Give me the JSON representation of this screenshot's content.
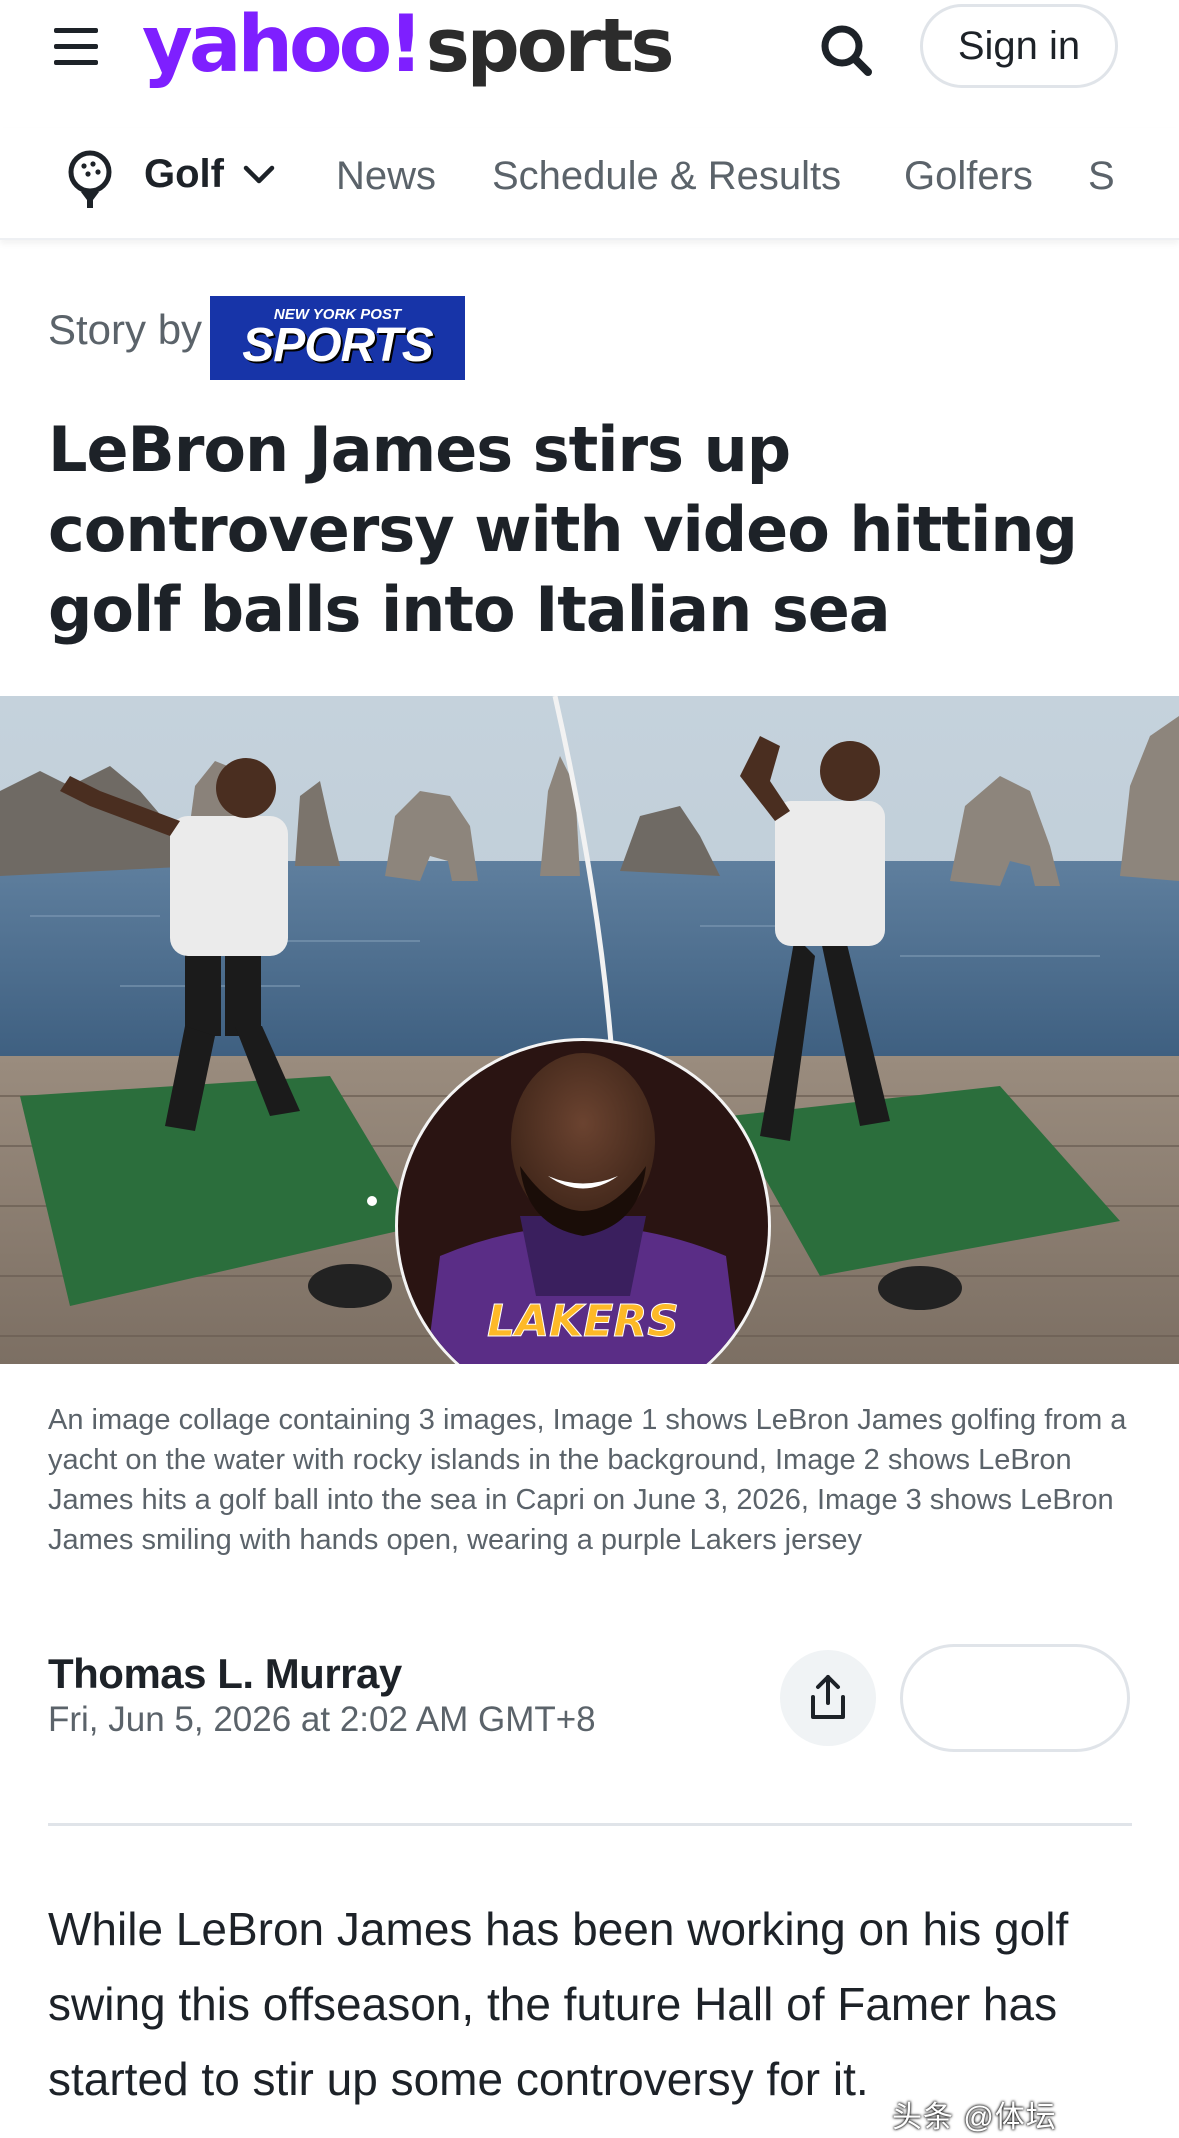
{
  "header": {
    "logo_main": "yahoo!",
    "logo_sub": "sports",
    "sign_in_label": "Sign in"
  },
  "subnav": {
    "sport_label": "Golf",
    "links": [
      "News",
      "Schedule & Results",
      "Golfers",
      "S"
    ]
  },
  "story": {
    "story_by_label": "Story by",
    "source_logo_small": "NEW YORK POST",
    "source_logo_big": "SPORTS",
    "headline": "LeBron James stirs up controversy with video hitting golf balls into Italian sea",
    "caption": "An image collage containing 3 images, Image 1 shows LeBron James golfing from a yacht on the water with rocky islands in the background, Image 2 shows LeBron James hits a golf ball into the sea in Capri on June 3, 2026, Image 3 shows LeBron James smiling with hands open, wearing a purple Lakers jersey",
    "jersey_text": "LAKERS",
    "author": "Thomas L. Murray",
    "date": "Fri, Jun 5, 2026 at 2:02 AM GMT+8",
    "body_intro": "While LeBron James has been working on his golf swing this offseason, the future Hall of Famer has started to stir up some controversy for it."
  },
  "watermark": "头条 @体坛"
}
